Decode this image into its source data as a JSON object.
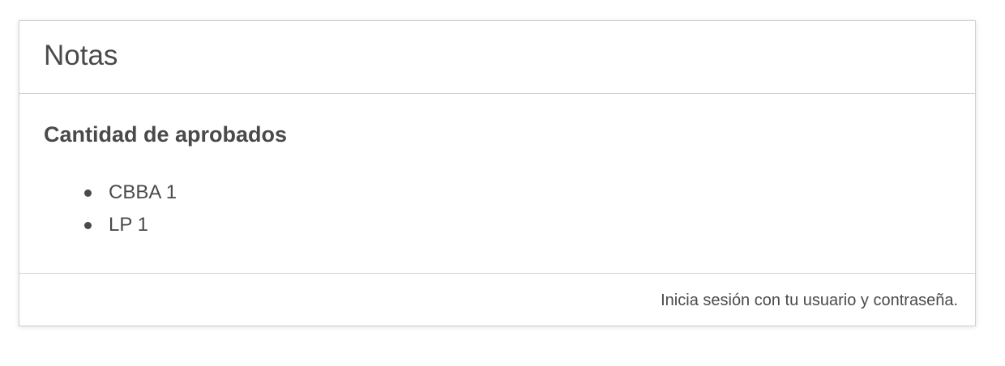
{
  "card": {
    "title": "Notas",
    "section_heading": "Cantidad de aprobados",
    "items": [
      {
        "label": "CBBA 1"
      },
      {
        "label": "LP 1"
      }
    ],
    "footer_text": "Inicia sesión con tu usuario y contraseña."
  },
  "colors": {
    "text": "#4a4a4a",
    "border": "#cfcfcf",
    "background": "#ffffff"
  }
}
